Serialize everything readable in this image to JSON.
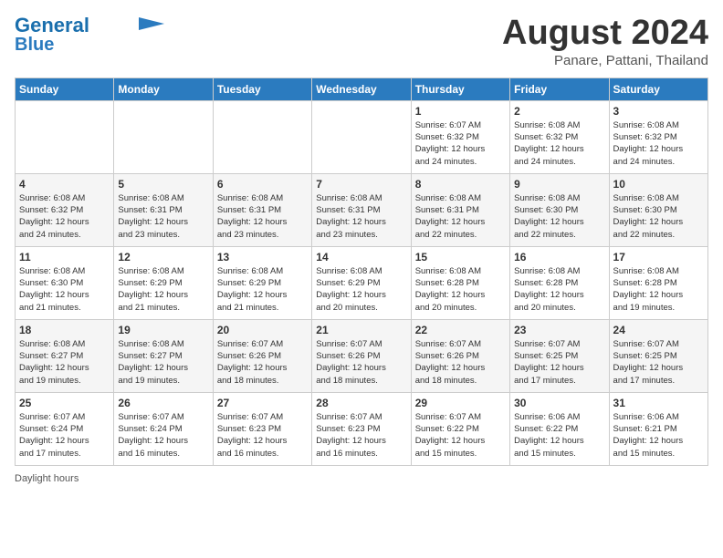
{
  "header": {
    "logo_line1": "General",
    "logo_line2": "Blue",
    "main_title": "August 2024",
    "subtitle": "Panare, Pattani, Thailand"
  },
  "days_of_week": [
    "Sunday",
    "Monday",
    "Tuesday",
    "Wednesday",
    "Thursday",
    "Friday",
    "Saturday"
  ],
  "footer_note": "Daylight hours",
  "weeks": [
    [
      {
        "day": "",
        "info": ""
      },
      {
        "day": "",
        "info": ""
      },
      {
        "day": "",
        "info": ""
      },
      {
        "day": "",
        "info": ""
      },
      {
        "day": "1",
        "info": "Sunrise: 6:07 AM\nSunset: 6:32 PM\nDaylight: 12 hours\nand 24 minutes."
      },
      {
        "day": "2",
        "info": "Sunrise: 6:08 AM\nSunset: 6:32 PM\nDaylight: 12 hours\nand 24 minutes."
      },
      {
        "day": "3",
        "info": "Sunrise: 6:08 AM\nSunset: 6:32 PM\nDaylight: 12 hours\nand 24 minutes."
      }
    ],
    [
      {
        "day": "4",
        "info": "Sunrise: 6:08 AM\nSunset: 6:32 PM\nDaylight: 12 hours\nand 24 minutes."
      },
      {
        "day": "5",
        "info": "Sunrise: 6:08 AM\nSunset: 6:31 PM\nDaylight: 12 hours\nand 23 minutes."
      },
      {
        "day": "6",
        "info": "Sunrise: 6:08 AM\nSunset: 6:31 PM\nDaylight: 12 hours\nand 23 minutes."
      },
      {
        "day": "7",
        "info": "Sunrise: 6:08 AM\nSunset: 6:31 PM\nDaylight: 12 hours\nand 23 minutes."
      },
      {
        "day": "8",
        "info": "Sunrise: 6:08 AM\nSunset: 6:31 PM\nDaylight: 12 hours\nand 22 minutes."
      },
      {
        "day": "9",
        "info": "Sunrise: 6:08 AM\nSunset: 6:30 PM\nDaylight: 12 hours\nand 22 minutes."
      },
      {
        "day": "10",
        "info": "Sunrise: 6:08 AM\nSunset: 6:30 PM\nDaylight: 12 hours\nand 22 minutes."
      }
    ],
    [
      {
        "day": "11",
        "info": "Sunrise: 6:08 AM\nSunset: 6:30 PM\nDaylight: 12 hours\nand 21 minutes."
      },
      {
        "day": "12",
        "info": "Sunrise: 6:08 AM\nSunset: 6:29 PM\nDaylight: 12 hours\nand 21 minutes."
      },
      {
        "day": "13",
        "info": "Sunrise: 6:08 AM\nSunset: 6:29 PM\nDaylight: 12 hours\nand 21 minutes."
      },
      {
        "day": "14",
        "info": "Sunrise: 6:08 AM\nSunset: 6:29 PM\nDaylight: 12 hours\nand 20 minutes."
      },
      {
        "day": "15",
        "info": "Sunrise: 6:08 AM\nSunset: 6:28 PM\nDaylight: 12 hours\nand 20 minutes."
      },
      {
        "day": "16",
        "info": "Sunrise: 6:08 AM\nSunset: 6:28 PM\nDaylight: 12 hours\nand 20 minutes."
      },
      {
        "day": "17",
        "info": "Sunrise: 6:08 AM\nSunset: 6:28 PM\nDaylight: 12 hours\nand 19 minutes."
      }
    ],
    [
      {
        "day": "18",
        "info": "Sunrise: 6:08 AM\nSunset: 6:27 PM\nDaylight: 12 hours\nand 19 minutes."
      },
      {
        "day": "19",
        "info": "Sunrise: 6:08 AM\nSunset: 6:27 PM\nDaylight: 12 hours\nand 19 minutes."
      },
      {
        "day": "20",
        "info": "Sunrise: 6:07 AM\nSunset: 6:26 PM\nDaylight: 12 hours\nand 18 minutes."
      },
      {
        "day": "21",
        "info": "Sunrise: 6:07 AM\nSunset: 6:26 PM\nDaylight: 12 hours\nand 18 minutes."
      },
      {
        "day": "22",
        "info": "Sunrise: 6:07 AM\nSunset: 6:26 PM\nDaylight: 12 hours\nand 18 minutes."
      },
      {
        "day": "23",
        "info": "Sunrise: 6:07 AM\nSunset: 6:25 PM\nDaylight: 12 hours\nand 17 minutes."
      },
      {
        "day": "24",
        "info": "Sunrise: 6:07 AM\nSunset: 6:25 PM\nDaylight: 12 hours\nand 17 minutes."
      }
    ],
    [
      {
        "day": "25",
        "info": "Sunrise: 6:07 AM\nSunset: 6:24 PM\nDaylight: 12 hours\nand 17 minutes."
      },
      {
        "day": "26",
        "info": "Sunrise: 6:07 AM\nSunset: 6:24 PM\nDaylight: 12 hours\nand 16 minutes."
      },
      {
        "day": "27",
        "info": "Sunrise: 6:07 AM\nSunset: 6:23 PM\nDaylight: 12 hours\nand 16 minutes."
      },
      {
        "day": "28",
        "info": "Sunrise: 6:07 AM\nSunset: 6:23 PM\nDaylight: 12 hours\nand 16 minutes."
      },
      {
        "day": "29",
        "info": "Sunrise: 6:07 AM\nSunset: 6:22 PM\nDaylight: 12 hours\nand 15 minutes."
      },
      {
        "day": "30",
        "info": "Sunrise: 6:06 AM\nSunset: 6:22 PM\nDaylight: 12 hours\nand 15 minutes."
      },
      {
        "day": "31",
        "info": "Sunrise: 6:06 AM\nSunset: 6:21 PM\nDaylight: 12 hours\nand 15 minutes."
      }
    ]
  ]
}
